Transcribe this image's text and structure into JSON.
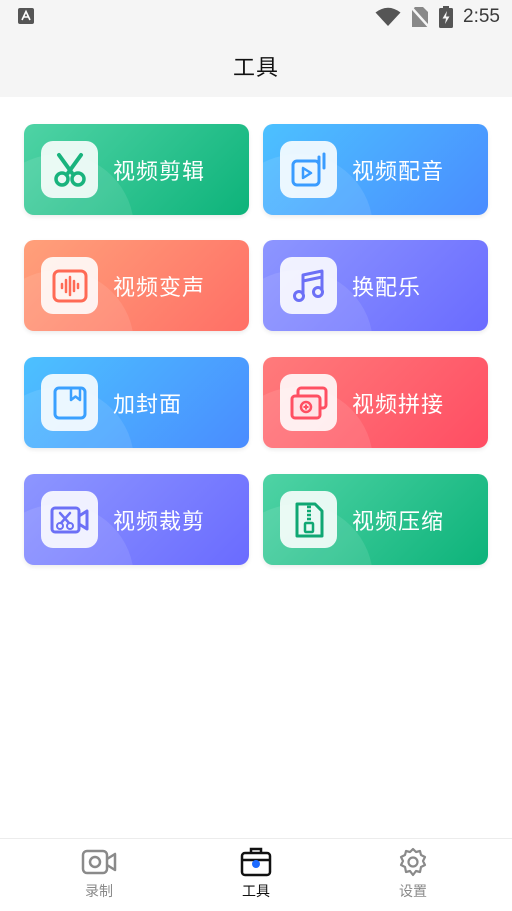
{
  "status_bar": {
    "time": "2:55",
    "icons": [
      "notification-a-icon",
      "wifi-icon",
      "no-sim-icon",
      "battery-charging-icon"
    ]
  },
  "header": {
    "title": "工具"
  },
  "tools": [
    {
      "label": "视频剪辑",
      "icon": "scissors-icon",
      "gradient": [
        "#4fd3a5",
        "#0db37a"
      ],
      "accent": "#19b37d"
    },
    {
      "label": "视频配音",
      "icon": "voiceover-icon",
      "gradient": [
        "#4cc1ff",
        "#4a8cff"
      ],
      "accent": "#3a9cff"
    },
    {
      "label": "视频变声",
      "icon": "voice-change-icon",
      "gradient": [
        "#ffa07a",
        "#ff6f66"
      ],
      "accent": "#ff6a55"
    },
    {
      "label": "换配乐",
      "icon": "music-note-icon",
      "gradient": [
        "#8d96ff",
        "#6a6bff"
      ],
      "accent": "#6c70f6"
    },
    {
      "label": "加封面",
      "icon": "cover-icon",
      "gradient": [
        "#4cc1ff",
        "#4a8cff"
      ],
      "accent": "#3aa0ff"
    },
    {
      "label": "视频拼接",
      "icon": "splice-icon",
      "gradient": [
        "#ff7b7b",
        "#ff4d63"
      ],
      "accent": "#ff4f62"
    },
    {
      "label": "视频裁剪",
      "icon": "video-cut-icon",
      "gradient": [
        "#8d96ff",
        "#6a6bff"
      ],
      "accent": "#6c70f6"
    },
    {
      "label": "视频压缩",
      "icon": "zip-file-icon",
      "gradient": [
        "#4fd3a5",
        "#0db37a"
      ],
      "accent": "#10a773"
    }
  ],
  "nav": {
    "items": [
      {
        "label": "录制",
        "icon": "video-camera-icon",
        "active": false
      },
      {
        "label": "工具",
        "icon": "toolbox-icon",
        "active": true
      },
      {
        "label": "设置",
        "icon": "gear-icon",
        "active": false
      }
    ],
    "active_color": "#111111",
    "inactive_color": "#8a8a8a"
  }
}
